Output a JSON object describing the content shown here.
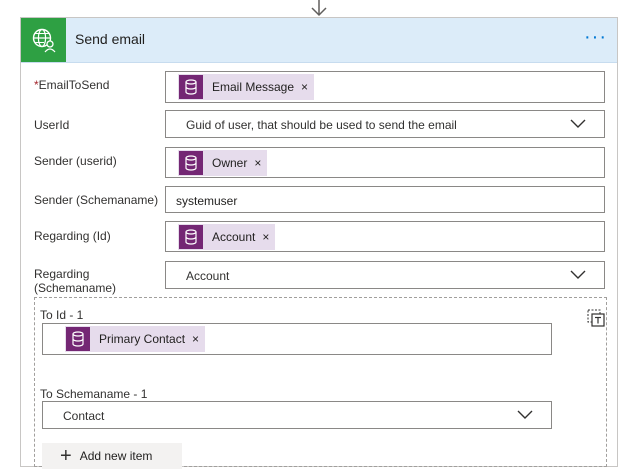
{
  "card": {
    "title": "Send email",
    "more_label": "···",
    "header_icon": "globe-user-icon",
    "header_color": "#2ea043"
  },
  "fields": {
    "email_to_send": {
      "label": "EmailToSend",
      "required_mark": "*",
      "token": "Email Message"
    },
    "userid": {
      "label": "UserId",
      "placeholder": "Guid of user, that should be used to send the email"
    },
    "sender_userid": {
      "label": "Sender (userid)",
      "token": "Owner"
    },
    "sender_schemaname": {
      "label": "Sender (Schemaname)",
      "value": "systemuser"
    },
    "regarding_id": {
      "label": "Regarding (Id)",
      "token": "Account"
    },
    "regarding_schemaname": {
      "label_line1": "Regarding",
      "label_line2": "(Schemaname)",
      "value": "Account"
    }
  },
  "array": {
    "to_id_label": "To Id - 1",
    "to_id_token": "Primary Contact",
    "to_schemaname_label": "To Schemaname - 1",
    "to_schemaname_value": "Contact",
    "add_item_label": "Add new item"
  },
  "token_remove": "×",
  "token_color": "#742774"
}
